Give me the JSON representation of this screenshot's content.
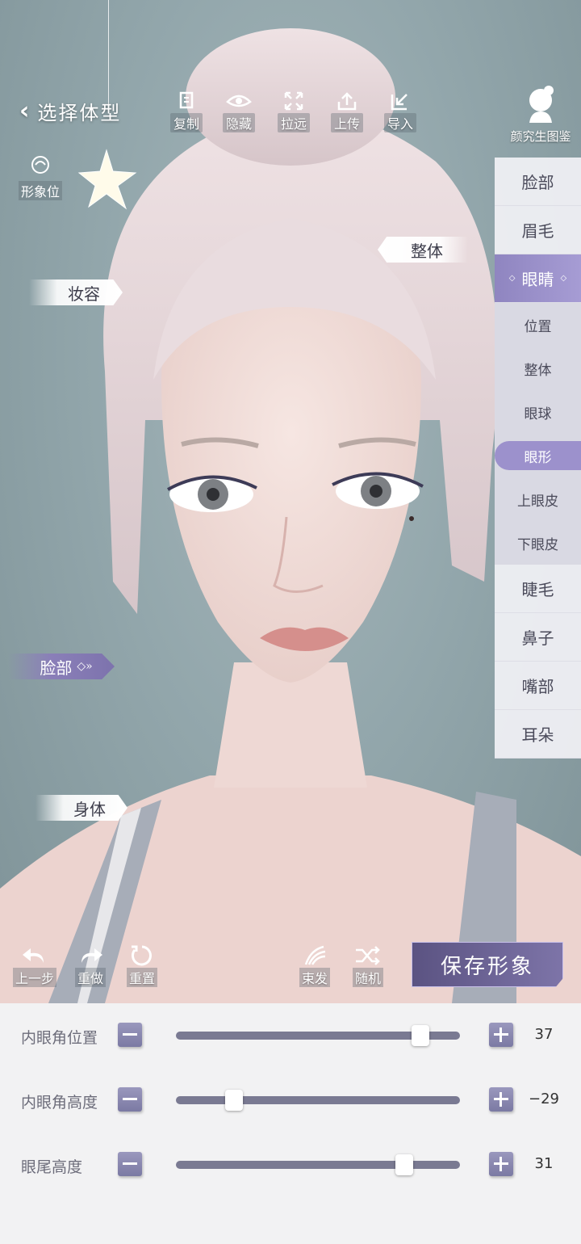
{
  "header": {
    "back_title": "选择体型",
    "tools": [
      {
        "label": "复制",
        "icon": "copy-icon"
      },
      {
        "label": "隐藏",
        "icon": "eye-icon"
      },
      {
        "label": "拉远",
        "icon": "zoom-out-icon"
      },
      {
        "label": "上传",
        "icon": "upload-icon"
      },
      {
        "label": "导入",
        "icon": "import-icon"
      }
    ],
    "guide_label": "颜究生图鉴",
    "slot_label": "形象位"
  },
  "scene_tags": {
    "whole": "整体",
    "makeup": "妆容",
    "face": "脸部",
    "body": "身体"
  },
  "sidebar": {
    "items": [
      "脸部",
      "眉毛",
      "眼睛",
      "睫毛",
      "鼻子",
      "嘴部",
      "耳朵"
    ],
    "active": "眼睛",
    "sub_items": [
      "位置",
      "整体",
      "眼球",
      "眼形",
      "上眼皮",
      "下眼皮"
    ],
    "active_sub": "眼形"
  },
  "bottom_tools": {
    "undo": "上一步",
    "redo": "重做",
    "reset": "重置",
    "tie_hair": "束发",
    "random": "随机",
    "save": "保存形象"
  },
  "sliders": [
    {
      "label": "内眼角位置",
      "value": "37",
      "fraction": 0.86
    },
    {
      "label": "内眼角高度",
      "value": "−29",
      "fraction": 0.205
    },
    {
      "label": "眼尾高度",
      "value": "31",
      "fraction": 0.805
    }
  ],
  "colors": {
    "accent": "#8f85c0",
    "save_button": "#5b5382",
    "slider_track": "#7a7a92"
  }
}
